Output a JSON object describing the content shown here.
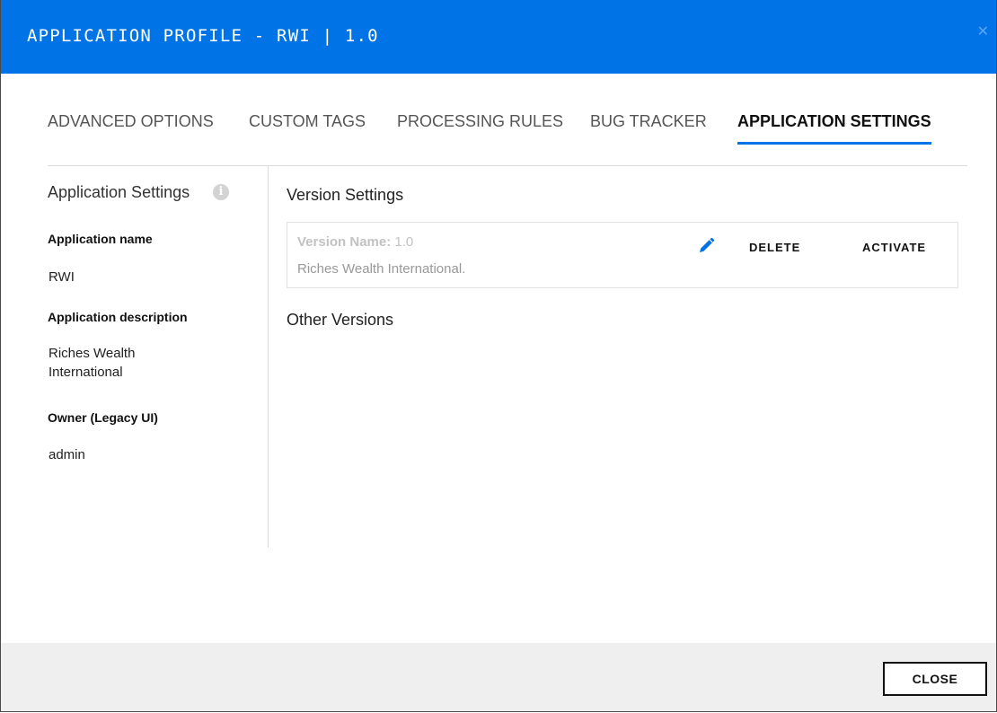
{
  "window": {
    "title": "APPLICATION PROFILE - RWI | 1.0",
    "accent_color": "#0073e7"
  },
  "tabs": [
    {
      "label": "ADVANCED OPTIONS",
      "active": false
    },
    {
      "label": "CUSTOM TAGS",
      "active": false
    },
    {
      "label": "PROCESSING RULES",
      "active": false
    },
    {
      "label": "BUG TRACKER",
      "active": false
    },
    {
      "label": "APPLICATION SETTINGS",
      "active": true
    }
  ],
  "sidebar": {
    "heading": "Application Settings",
    "info_icon": "info-icon",
    "fields": [
      {
        "label": "Application name",
        "value": "RWI"
      },
      {
        "label": "Application description",
        "value": "Riches Wealth International"
      },
      {
        "label": "Owner (Legacy UI)",
        "value": "admin"
      }
    ]
  },
  "main": {
    "version_settings_title": "Version Settings",
    "version": {
      "name_label": "Version Name:",
      "name_value": "1.0",
      "description": "Riches Wealth International.",
      "edit_icon": "pencil-icon",
      "delete_label": "DELETE",
      "activate_label": "ACTIVATE"
    },
    "other_versions_title": "Other Versions"
  },
  "footer": {
    "close_label": "CLOSE"
  }
}
